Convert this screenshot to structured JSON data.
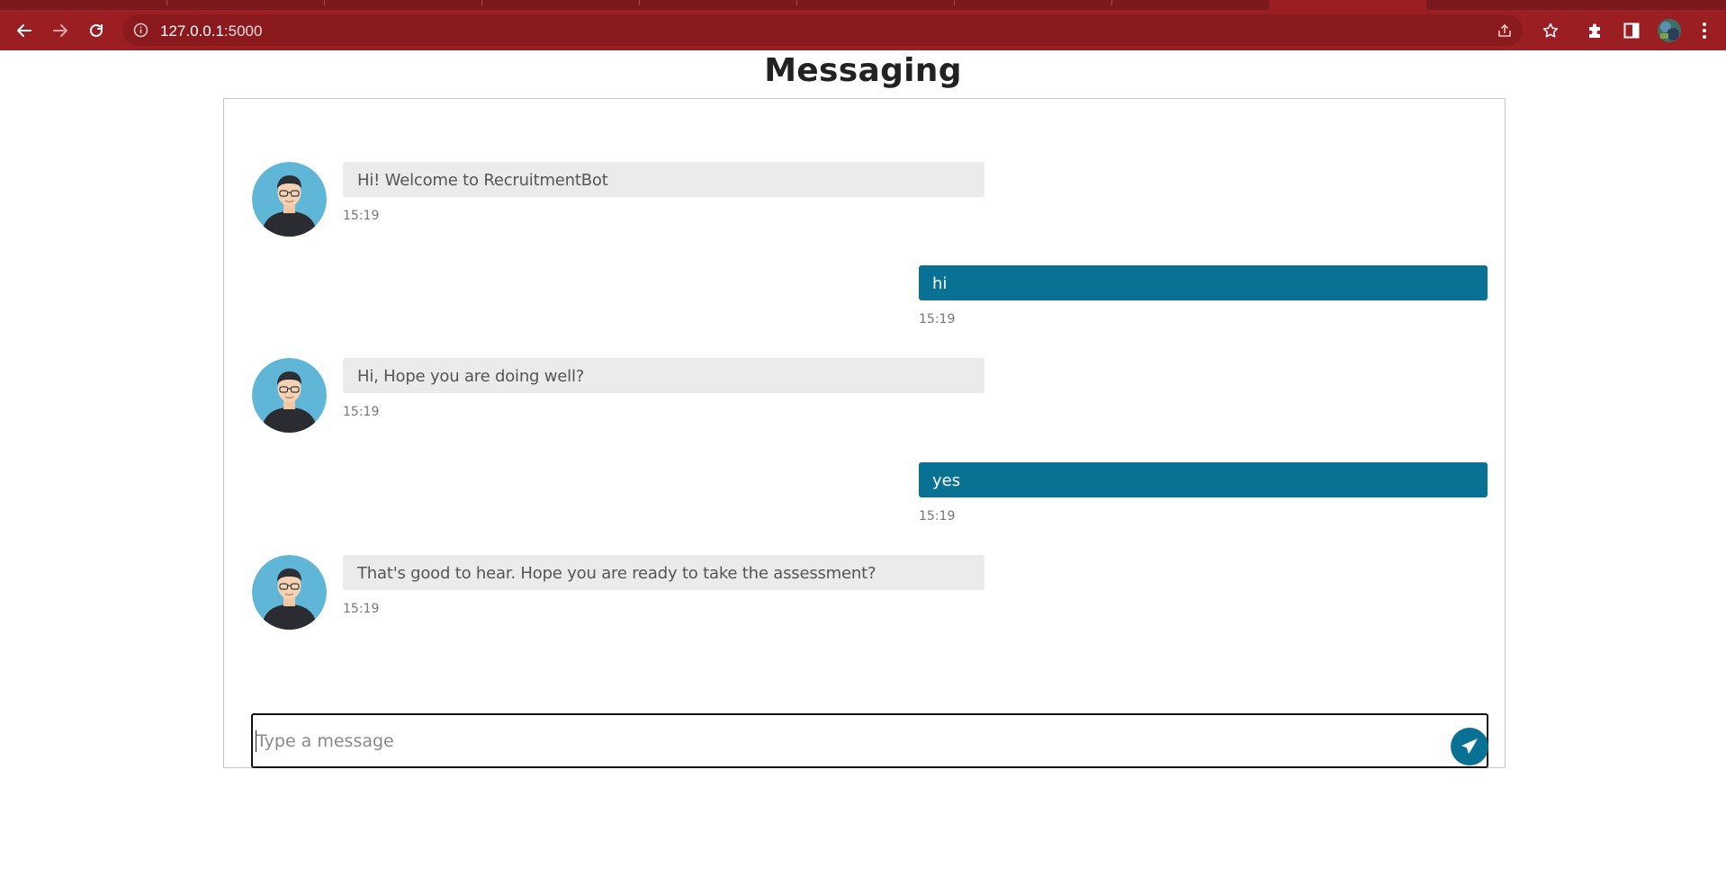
{
  "browser": {
    "url_host": "127.0.0.1",
    "url_port": ":5000",
    "chrome_color": "#9b1e22",
    "icons": [
      "back-arrow-icon",
      "forward-arrow-icon",
      "reload-icon",
      "info-icon",
      "share-icon",
      "bookmark-star-icon",
      "extensions-icon",
      "side-panel-icon",
      "profile-avatar",
      "kebab-menu-icon"
    ]
  },
  "page": {
    "title": "Messaging"
  },
  "messages": [
    {
      "from": "bot",
      "text": "Hi! Welcome to RecruitmentBot",
      "time": "15:19"
    },
    {
      "from": "user",
      "text": "hi",
      "time": "15:19"
    },
    {
      "from": "bot",
      "text": "Hi, Hope you are doing well?",
      "time": "15:19"
    },
    {
      "from": "user",
      "text": "yes",
      "time": "15:19"
    },
    {
      "from": "bot",
      "text": "That's good to hear. Hope you are ready to take the assessment?",
      "time": "15:19"
    }
  ],
  "composer": {
    "placeholder": "Type a message",
    "value": ""
  },
  "colors": {
    "user_bubble": "#097193",
    "bot_bubble": "#ebebeb",
    "avatar_bg": "#5fb6d6",
    "send_button": "#097193"
  }
}
